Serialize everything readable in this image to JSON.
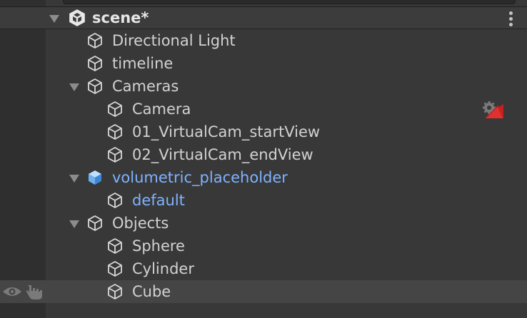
{
  "hierarchy": {
    "scene": {
      "name": "scene*"
    },
    "rows": [
      {
        "label": "Directional Light",
        "kind": "gameobject"
      },
      {
        "label": "timeline",
        "kind": "gameobject"
      },
      {
        "label": "Cameras",
        "kind": "gameobject",
        "expanded": true
      },
      {
        "label": "Camera",
        "kind": "gameobject",
        "badge": "camera-warning-icon"
      },
      {
        "label": "01_VirtualCam_startView",
        "kind": "gameobject"
      },
      {
        "label": "02_VirtualCam_endView",
        "kind": "gameobject"
      },
      {
        "label": "volumetric_placeholder",
        "kind": "prefab",
        "expanded": true
      },
      {
        "label": "default",
        "kind": "prefab-child"
      },
      {
        "label": "Objects",
        "kind": "gameobject",
        "expanded": true
      },
      {
        "label": "Sphere",
        "kind": "gameobject"
      },
      {
        "label": "Cylinder",
        "kind": "gameobject"
      },
      {
        "label": "Cube",
        "kind": "gameobject",
        "hovered": true
      }
    ]
  },
  "colors": {
    "background": "#383838",
    "gutter": "#2f2f2f",
    "text": "#d2d2d2",
    "prefab_text": "#7fb2ff",
    "hover_row": "#454545",
    "warning_badge": "#c81e1e"
  }
}
